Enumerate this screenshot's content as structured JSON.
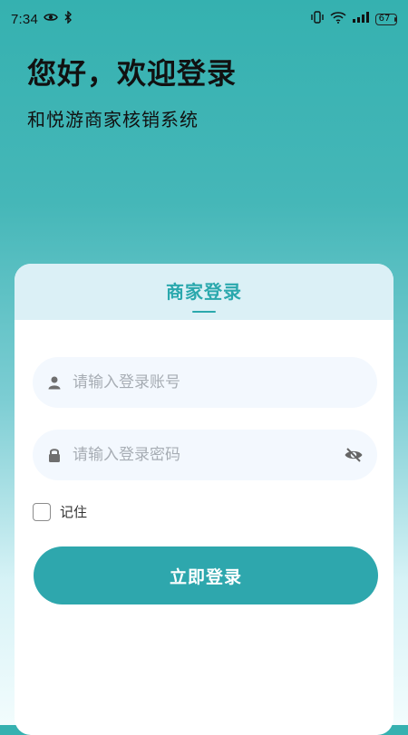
{
  "status_bar": {
    "time": "7:34",
    "battery": "67"
  },
  "hero": {
    "title": "您好，欢迎登录",
    "subtitle": "和悦游商家核销系统"
  },
  "card": {
    "title": "商家登录",
    "account_placeholder": "请输入登录账号",
    "password_placeholder": "请输入登录密码",
    "remember_label": "记住",
    "login_button": "立即登录"
  },
  "icons": {
    "status_left": [
      "eye-icon",
      "bluetooth-icon"
    ],
    "status_right": [
      "vibrate-icon",
      "wifi-icon",
      "signal-icon",
      "battery-icon"
    ],
    "account": "user-icon",
    "password": "lock-icon",
    "password_visibility": "eye-off-icon"
  },
  "colors": {
    "accent": "#2ea7ad",
    "header_bg": "#dbf0f6",
    "field_bg": "#f3f8fe"
  }
}
